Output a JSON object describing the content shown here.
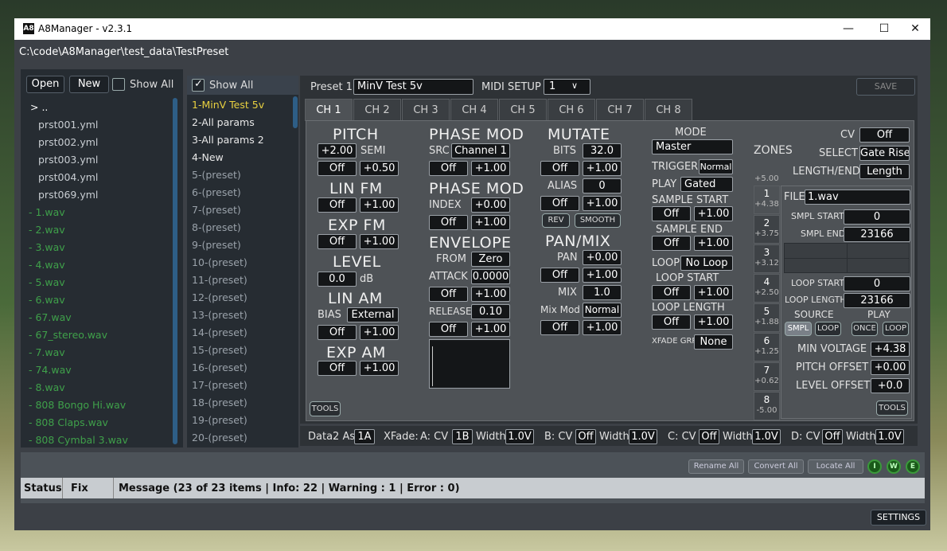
{
  "app": {
    "icon_text": "A8",
    "title": "A8Manager - v2.3.1",
    "path": "C:\\code\\A8Manager\\test_data\\TestPreset",
    "min_glyph": "—",
    "max_glyph": "☐",
    "close_glyph": "✕"
  },
  "files": {
    "open_label": "Open",
    "new_label": "New",
    "show_all_label": "Show All",
    "items": [
      ">  ..",
      "prst001.yml",
      "prst002.yml",
      "prst003.yml",
      "prst004.yml",
      "prst069.yml",
      "-  1.wav",
      "-  2.wav",
      "-  3.wav",
      "-  4.wav",
      "-  5.wav",
      "-  6.wav",
      "-  67.wav",
      "-  67_stereo.wav",
      "-  7.wav",
      "-  74.wav",
      "-  8.wav",
      "-  808 Bongo Hi.wav",
      "-  808 Claps.wav",
      "-  808 Cymbal 3.wav"
    ]
  },
  "presets": {
    "show_all_label": "Show All",
    "items": [
      "1-MinV Test 5v",
      "2-All params",
      "3-All params 2",
      "4-New",
      "5-(preset)",
      "6-(preset)",
      "7-(preset)",
      "8-(preset)",
      "9-(preset)",
      "10-(preset)",
      "11-(preset)",
      "12-(preset)",
      "13-(preset)",
      "14-(preset)",
      "15-(preset)",
      "16-(preset)",
      "17-(preset)",
      "18-(preset)",
      "19-(preset)",
      "20-(preset)"
    ]
  },
  "editor": {
    "preset_label": "Preset 1",
    "preset_name": "MinV Test 5v",
    "midi_label": "MIDI SETUP",
    "midi_value": "1",
    "save_label": "SAVE",
    "tabs": [
      "CH 1",
      "CH 2",
      "CH 3",
      "CH 4",
      "CH 5",
      "CH 6",
      "CH 7",
      "CH 8"
    ],
    "pitch": {
      "title": "PITCH",
      "semi_value": "+2.00",
      "semi_label": "SEMI",
      "cv": "Off",
      "amt": "+0.50"
    },
    "linfm": {
      "title": "LIN FM",
      "cv": "Off",
      "amt": "+1.00"
    },
    "expfm": {
      "title": "EXP FM",
      "cv": "Off",
      "amt": "+1.00"
    },
    "level": {
      "title": "LEVEL",
      "value": "0.0",
      "unit": "dB"
    },
    "linam": {
      "title": "LIN AM",
      "bias_label": "BIAS",
      "bias": "External",
      "cv": "Off",
      "amt": "+1.00"
    },
    "expam": {
      "title": "EXP AM",
      "cv": "Off",
      "amt": "+1.00"
    },
    "tools_label": "TOOLS",
    "phasemod1": {
      "title": "PHASE MOD",
      "src_label": "SRC",
      "src": "Channel 1",
      "cv": "Off",
      "amt": "+1.00"
    },
    "phasemod2": {
      "title": "PHASE MOD",
      "index_label": "INDEX",
      "index": "+0.00",
      "cv": "Off",
      "amt": "+1.00"
    },
    "envelope": {
      "title": "ENVELOPE",
      "from_label": "FROM",
      "from": "Zero",
      "attack_label": "ATTACK",
      "attack": "0.0000",
      "cv1": "Off",
      "amt1": "+1.00",
      "release_label": "RELEASE",
      "release": "0.10",
      "cv2": "Off",
      "amt2": "+1.00"
    },
    "mutate": {
      "title": "MUTATE",
      "bits_label": "BITS",
      "bits": "32.0",
      "cv1": "Off",
      "amt1": "+1.00",
      "alias_label": "ALIAS",
      "alias": "0",
      "cv2": "Off",
      "amt2": "+1.00",
      "rev": "REV",
      "smooth": "SMOOTH"
    },
    "panmix": {
      "title": "PAN/MIX",
      "pan_label": "PAN",
      "pan": "+0.00",
      "cv1": "Off",
      "amt1": "+1.00",
      "mix_label": "MIX",
      "mix": "1.0",
      "mixmod_label": "Mix Mod",
      "mixmod": "Normal",
      "cv2": "Off",
      "amt2": "+1.00"
    },
    "mode": {
      "title": "MODE",
      "value": "Master",
      "trigger_label": "TRIGGER",
      "trigger": "Normal",
      "play_label": "PLAY",
      "play": "Gated",
      "ss_label": "SAMPLE START",
      "ss_cv": "Off",
      "ss_amt": "+1.00",
      "se_label": "SAMPLE END",
      "se_cv": "Off",
      "se_amt": "+1.00",
      "loop_label": "LOOP",
      "loop": "No Loop",
      "ls_label": "LOOP START",
      "ls_cv": "Off",
      "ls_amt": "+1.00",
      "ll_label": "LOOP LENGTH",
      "ll_cv": "Off",
      "ll_amt": "+1.00",
      "xfade_label": "XFADE GRP",
      "xfade": "None"
    },
    "zones": {
      "title": "ZONES",
      "top_value": "+5.00",
      "cv_label": "CV",
      "cv": "Off",
      "select_label": "SELECT",
      "select": "Gate Rise",
      "lengthend_label": "LENGTH/END",
      "lengthend": "Length",
      "list": [
        {
          "n": "1",
          "v": "+4.38"
        },
        {
          "n": "2",
          "v": "+3.75"
        },
        {
          "n": "3",
          "v": "+3.12"
        },
        {
          "n": "4",
          "v": "+2.50"
        },
        {
          "n": "5",
          "v": "+1.88"
        },
        {
          "n": "6",
          "v": "+1.25"
        },
        {
          "n": "7",
          "v": "+0.62"
        },
        {
          "n": "8",
          "v": "-5.00"
        }
      ],
      "file_label": "FILE",
      "file": "1.wav",
      "smpl_start_label": "SMPL START",
      "smpl_start": "0",
      "smpl_end_label": "SMPL END",
      "smpl_end": "23166",
      "loop_start_label": "LOOP START",
      "loop_start": "0",
      "loop_length_label": "LOOP LENGTH",
      "loop_length": "23166",
      "source_label": "SOURCE",
      "play_label": "PLAY",
      "smpl": "SMPL",
      "loop": "LOOP",
      "once": "ONCE",
      "loop2": "LOOP",
      "minv_label": "MIN VOLTAGE",
      "minv": "+4.38",
      "pitchoff_label": "PITCH OFFSET",
      "pitchoff": "+0.00",
      "leveloff_label": "LEVEL OFFSET",
      "leveloff": "+0.0",
      "tools_label": "TOOLS"
    }
  },
  "bottom": {
    "data2_label": "Data2 As",
    "data2": "1A",
    "xfade_label": "XFade:",
    "a_label": "A: CV",
    "a_cv": "1B",
    "a_w_label": "Width",
    "a_w": "1.0V",
    "b_label": "B: CV",
    "b_cv": "Off",
    "b_w_label": "Width",
    "b_w": "1.0V",
    "c_label": "C: CV",
    "c_cv": "Off",
    "c_w_label": "Width",
    "c_w": "1.0V",
    "d_label": "D: CV",
    "d_cv": "Off",
    "d_w_label": "Width",
    "d_w": "1.0V"
  },
  "status": {
    "rename_all": "Rename All",
    "convert_all": "Convert All",
    "locate_all": "Locate All",
    "i": "I",
    "w": "W",
    "e": "E",
    "col_status": "Status",
    "col_fix": "Fix",
    "col_message": "Message (23 of 23 items | Info: 22 | Warning : 1 | Error : 0)",
    "settings": "SETTINGS"
  }
}
